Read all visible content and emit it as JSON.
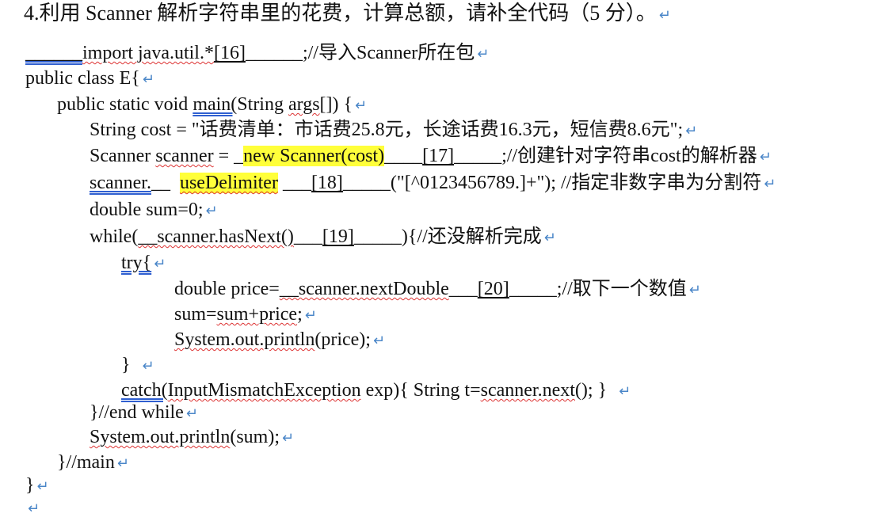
{
  "question_title": "4.利用 Scanner 解析字符串里的花费，计算总额，请补全代码（5 分）。",
  "para_mark": "↵",
  "code": {
    "l1_blank_lead": "______",
    "l1_import": "import java.util.*",
    "l1_num": "[16]",
    "l1_tail_blank": "______",
    "l1_rest": ";//导入Scanner所在包",
    "l2": "public class E{",
    "l3_pre": "public static void ",
    "l3_main": "main(",
    "l3_mid": "String ",
    "l3_args": "args",
    "l3_rest": "[]) {",
    "l4": "String cost = \"话费清单：市话费25.8元，长途话费16.3元，短信费8.6元\";",
    "l5_pre": "Scanner ",
    "l5_scanner": "scanner",
    "l5_eq": " = _",
    "l5_answer": "new Scanner(cost)",
    "l5_blank1": "____",
    "l5_num": "[17]",
    "l5_blank2": "_____",
    "l5_rest": ";//创建针对字符串cost的解析器",
    "l6_scanner": "scanner.",
    "l6_blank1": "__",
    "l6_answer": "useDelimiter",
    "l6_blank2": "___",
    "l6_num": "[18]",
    "l6_blank3": "_____",
    "l6_rest": "(\"[^0123456789.]+\"); //指定非数字串为分割符",
    "l7": "double sum=0;",
    "l8_pre": "while(",
    "l8_answer": "__scanner.hasNext()",
    "l8_blank1": "___",
    "l8_num": "[19]",
    "l8_blank2": "_____",
    "l8_rest": "){//还没解析完成",
    "l9": "try{",
    "l10_pre": "double price=",
    "l10_answer": "__scanner.nextDouble",
    "l10_blank1": "___",
    "l10_num": "[20]",
    "l10_blank2": "_____",
    "l10_rest": ";//取下一个数值",
    "l11_pre": "sum=",
    "l11_mid": "sum+price",
    "l11_rest": ";",
    "l12_sys": "System.out.println",
    "l12_rest": "(price);",
    "l13": "}",
    "l14_catch": "catch(",
    "l14_ex": "InputMismatchException",
    "l14_mid": " exp){ String t=",
    "l14_next": "scanner.next",
    "l14_rest": "(); }",
    "l15": "}//end while",
    "l16_sys": "System.out.println",
    "l16_rest": "(sum);",
    "l17": "}//main",
    "l18": "}"
  }
}
